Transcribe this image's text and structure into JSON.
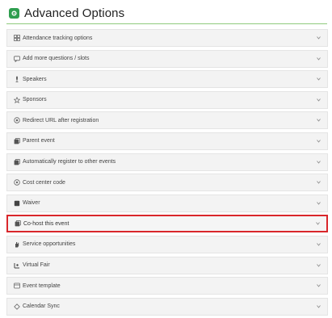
{
  "header": {
    "title": "Advanced Options",
    "icon": "gear-icon",
    "accent": "#2e9e4f"
  },
  "items": [
    {
      "label": "Attendance tracking options",
      "icon": "grid-icon"
    },
    {
      "label": "Add more questions / slots",
      "icon": "comment-icon"
    },
    {
      "label": "Speakers",
      "icon": "microphone-icon"
    },
    {
      "label": "Sponsors",
      "icon": "star-icon"
    },
    {
      "label": "Redirect URL after registration",
      "icon": "redirect-icon"
    },
    {
      "label": "Parent event",
      "icon": "copy-icon"
    },
    {
      "label": "Automatically register to other events",
      "icon": "copy-icon"
    },
    {
      "label": "Cost center code",
      "icon": "circle-icon"
    },
    {
      "label": "Waiver",
      "icon": "square-icon"
    },
    {
      "label": "Co-host this event",
      "icon": "copy-icon",
      "highlighted": true
    },
    {
      "label": "Service opportunities",
      "icon": "hand-icon"
    },
    {
      "label": "Virtual Fair",
      "icon": "virtual-icon"
    },
    {
      "label": "Event template",
      "icon": "template-icon"
    },
    {
      "label": "Calendar Sync",
      "icon": "sync-icon"
    }
  ],
  "highlight_color": "#d9262b"
}
